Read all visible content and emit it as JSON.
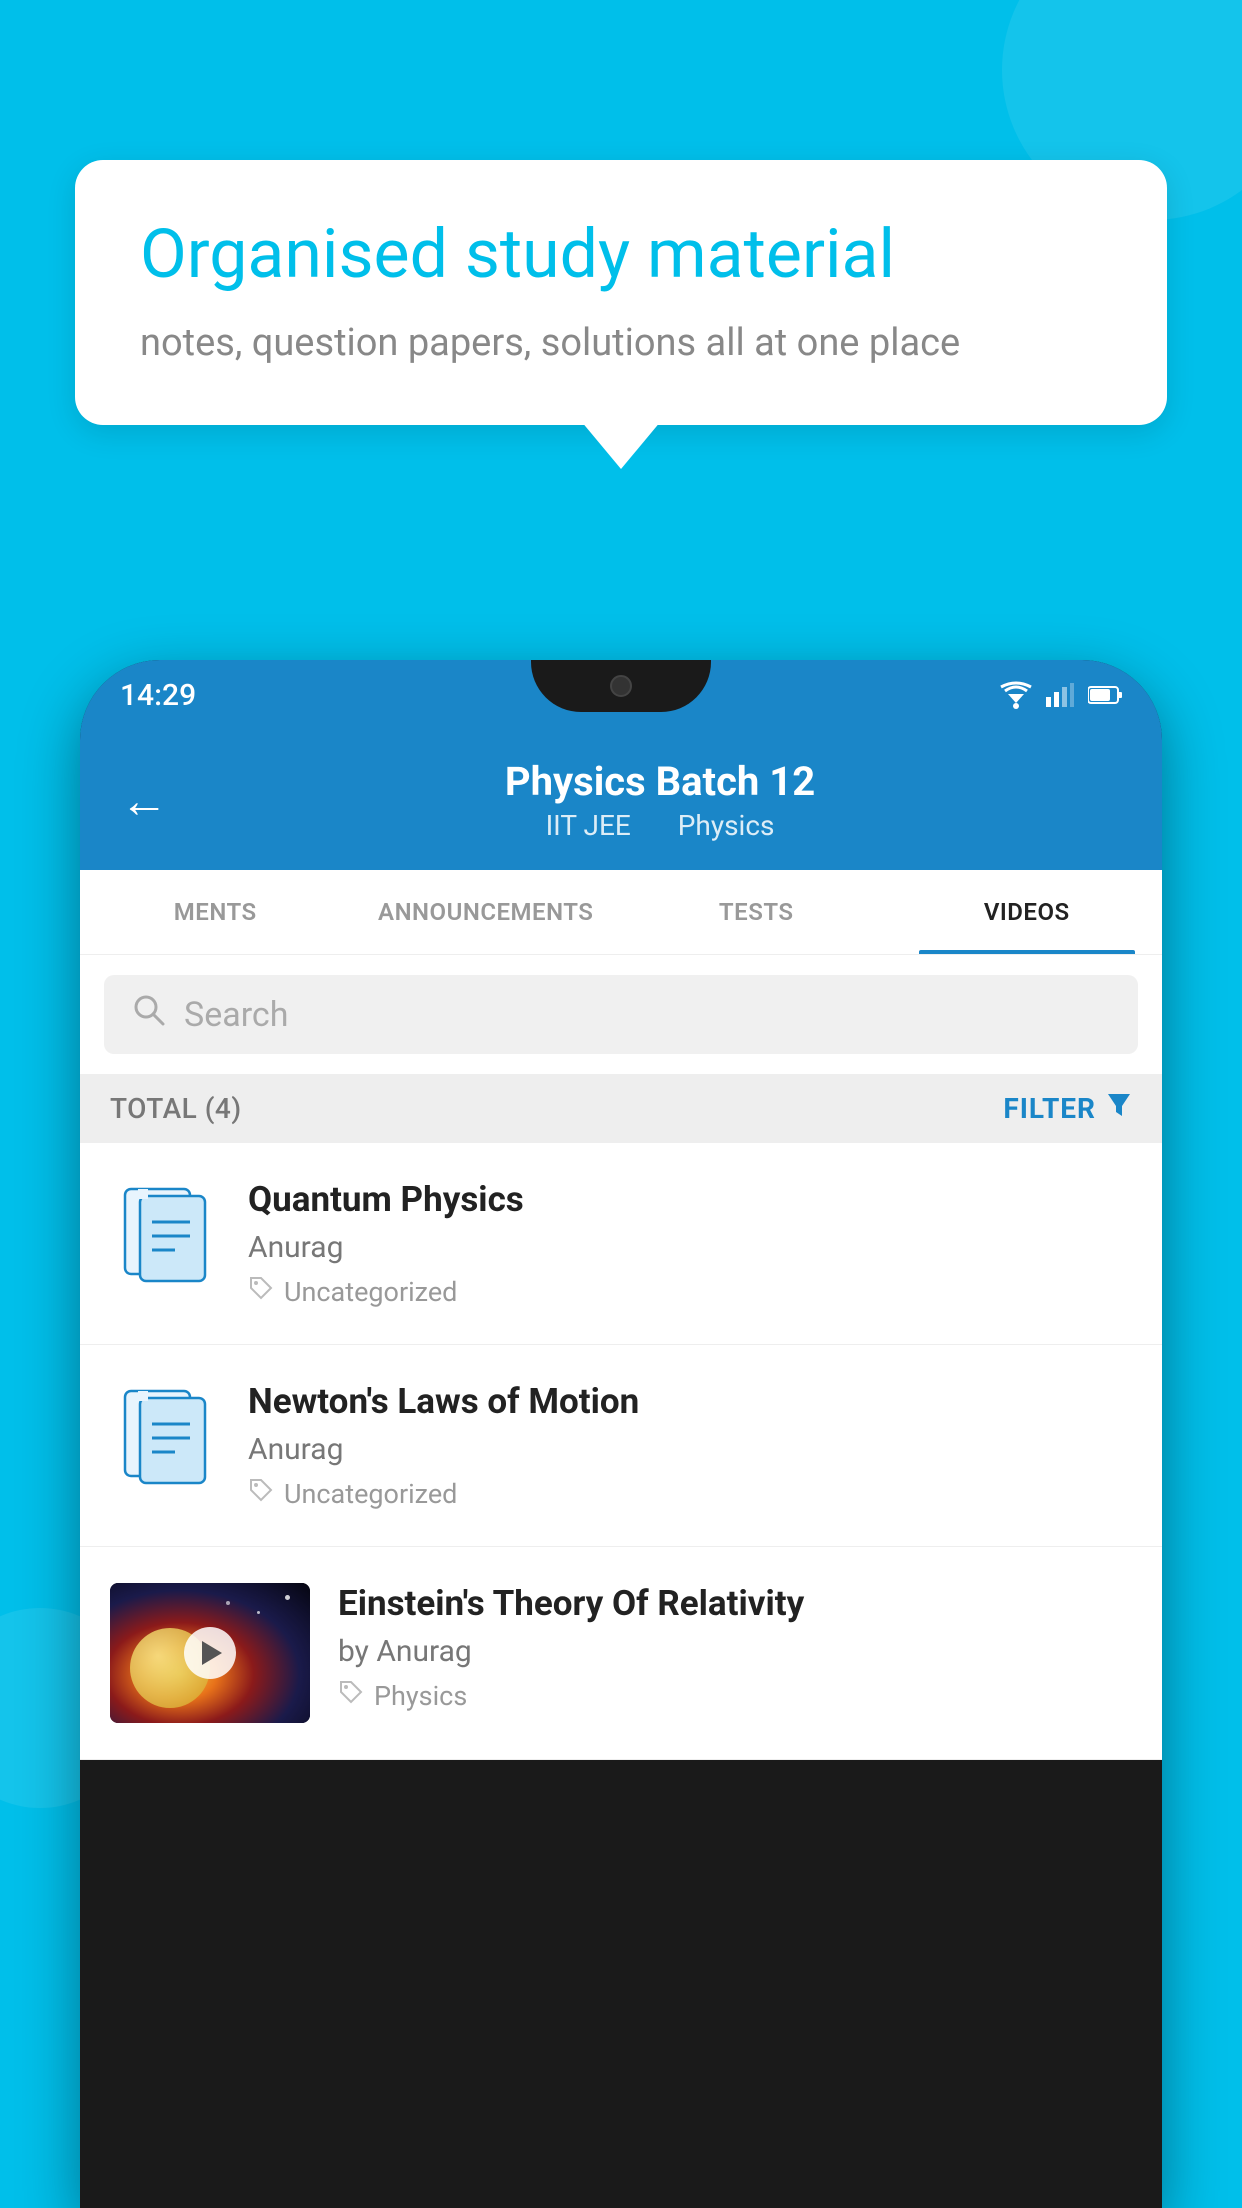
{
  "background_color": "#00BFEA",
  "speech_bubble": {
    "heading": "Organised study material",
    "subtext": "notes, question papers, solutions all at one place"
  },
  "status_bar": {
    "time": "14:29"
  },
  "app_header": {
    "title": "Physics Batch 12",
    "subtitle_part1": "IIT JEE",
    "subtitle_part2": "Physics",
    "back_label": "←"
  },
  "tabs": [
    {
      "label": "MENTS",
      "active": false
    },
    {
      "label": "ANNOUNCEMENTS",
      "active": false
    },
    {
      "label": "TESTS",
      "active": false
    },
    {
      "label": "VIDEOS",
      "active": true
    }
  ],
  "search": {
    "placeholder": "Search"
  },
  "filter_bar": {
    "total_label": "TOTAL (4)",
    "filter_label": "FILTER"
  },
  "videos": [
    {
      "title": "Quantum Physics",
      "author": "Anurag",
      "tag": "Uncategorized",
      "has_thumbnail": false
    },
    {
      "title": "Newton's Laws of Motion",
      "author": "Anurag",
      "tag": "Uncategorized",
      "has_thumbnail": false
    },
    {
      "title": "Einstein's Theory Of Relativity",
      "author": "by Anurag",
      "tag": "Physics",
      "has_thumbnail": true
    }
  ]
}
